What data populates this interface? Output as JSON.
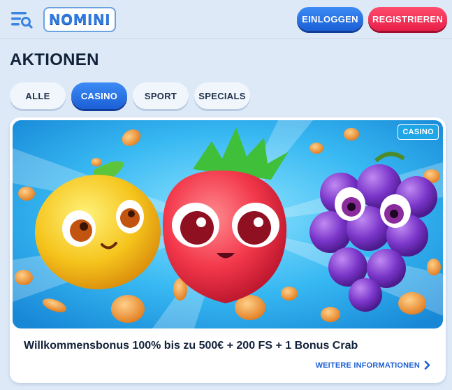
{
  "header": {
    "logo_text": "NOMINI",
    "login_label": "EINLOGGEN",
    "register_label": "REGISTRIEREN"
  },
  "page": {
    "title": "AKTIONEN"
  },
  "tabs": [
    {
      "label": "ALLE",
      "active": false
    },
    {
      "label": "CASINO",
      "active": true
    },
    {
      "label": "SPORT",
      "active": false
    },
    {
      "label": "SPECIALS",
      "active": false
    }
  ],
  "promo": {
    "badge": "CASINO",
    "title": "Willkommensbonus 100% bis zu 500€ + 200 FS + 1 Bonus Crab",
    "link_label": "WEITERE INFORMATIONEN",
    "link_icon": "chevron-right-icon"
  },
  "colors": {
    "accent_blue": "#1b5fd6",
    "register_red": "#e81f48",
    "background": "#dde9f7"
  }
}
